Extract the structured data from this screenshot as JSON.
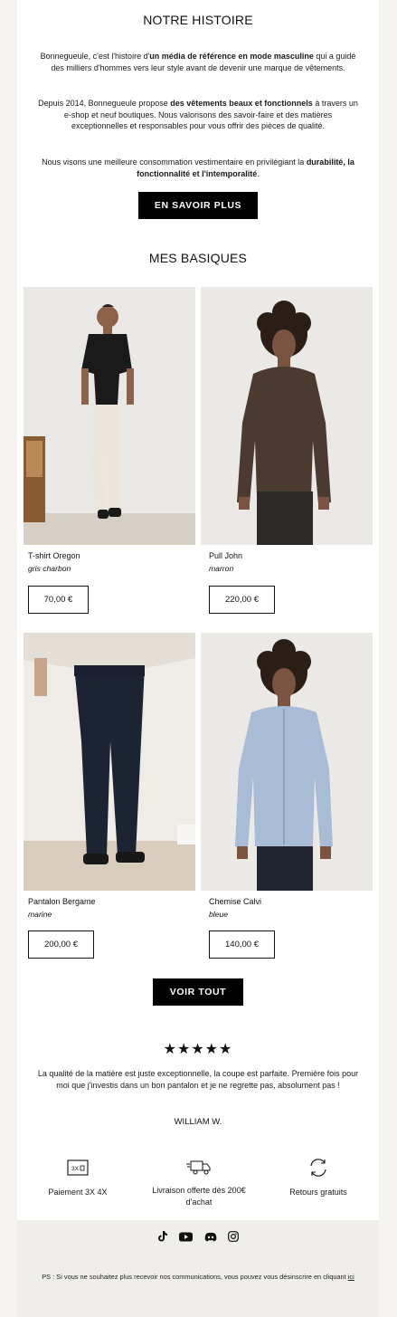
{
  "story": {
    "title": "NOTRE HISTOIRE",
    "p1_a": "Bonnegueule, c'est l'histoire d'",
    "p1_b": "un média de référence en mode masculine",
    "p1_c": " qui a guidé des milliers d'hommes vers leur style avant de devenir une marque de vêtements.",
    "p2_a": "Depuis 2014, Bonnegueule propose ",
    "p2_b": "des vêtements beaux et fonctionnels",
    "p2_c": " à travers un e-shop et neuf boutiques. Nous valorisons des savoir-faire et des matières exceptionnelles et responsables pour vous offrir des pièces de qualité.",
    "p3_a": "Nous visons une meilleure consommation vestimentaire en privilégiant la ",
    "p3_b": "durabilité, la fonctionnalité et l'intemporalité",
    "p3_c": ".",
    "button": "EN SAVOIR PLUS"
  },
  "basics": {
    "title": "MES BASIQUES",
    "products": [
      {
        "name": "T-shirt Oregon",
        "color": "gris charbon",
        "price": "70,00 €"
      },
      {
        "name": "Pull John",
        "color": "marron",
        "price": "220,00 €"
      },
      {
        "name": "Pantalon Bergame",
        "color": "marine",
        "price": "200,00 €"
      },
      {
        "name": "Chemise Calvi",
        "color": "bleue",
        "price": "140,00 €"
      }
    ],
    "button": "VOIR TOUT"
  },
  "review": {
    "stars": "★★★★★",
    "rating": 5,
    "text": "La qualité de la matière est juste exceptionnelle, la coupe est parfaite. Première fois pour moi que j'investis dans un bon pantalon et je ne regrette pas, absolument pas !",
    "author": "WILLIAM W."
  },
  "features": [
    {
      "icon": "payment-3x-icon",
      "label": "Paiement 3X 4X",
      "icon_text": "3X"
    },
    {
      "icon": "delivery-truck-icon",
      "label": "Livraison offerte dès 200€ d'achat"
    },
    {
      "icon": "returns-arrows-icon",
      "label": "Retours gratuits"
    }
  ],
  "social": [
    "tiktok-icon",
    "youtube-icon",
    "discord-icon",
    "instagram-icon"
  ],
  "footer": {
    "ps": "PS : Si vous ne souhaitez plus recevoir nos communications, vous pouvez vous désinscrire en cliquant ",
    "link": "ici"
  },
  "colors": {
    "background": "#f5f4f1",
    "card": "#ffffff",
    "button": "#000000",
    "footer": "#efeeea"
  }
}
